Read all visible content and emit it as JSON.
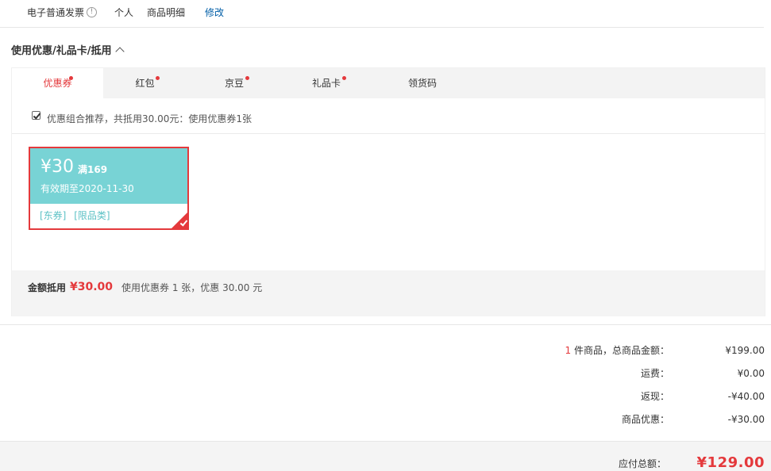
{
  "invoice": {
    "type": "电子普通发票",
    "info_icon": "info-icon",
    "title": "个人",
    "content": "商品明细",
    "edit_label": "修改"
  },
  "coupon_section": {
    "title": "使用优惠/礼品卡/抵用",
    "toggle_icon": "chevron-up-icon",
    "tabs": [
      {
        "label": "优惠券",
        "active": true,
        "dot": true
      },
      {
        "label": "红包",
        "active": false,
        "dot": true
      },
      {
        "label": "京豆",
        "active": false,
        "dot": true
      },
      {
        "label": "礼品卡",
        "active": false,
        "dot": true
      },
      {
        "label": "领货码",
        "active": false,
        "dot": false
      }
    ],
    "recommend": {
      "checked": true,
      "text": "优惠组合推荐，共抵用30.00元：使用优惠券1张"
    },
    "coupon": {
      "amount": "¥30",
      "condition": "满169",
      "expiry": "有效期至2020-11-30",
      "tags": [
        "[东券]",
        "[限品类]"
      ],
      "selected": true
    },
    "summary": {
      "label": "金额抵用",
      "amount": "¥30.00",
      "desc": "使用优惠券 1 张，优惠 30.00 元"
    }
  },
  "totals": {
    "item_count": "1",
    "items_label": " 件商品，总商品金额：",
    "items_value": "¥199.00",
    "shipping_label": "运费：",
    "shipping_value": "¥0.00",
    "cashback_label": "返现：",
    "cashback_value": "-¥40.00",
    "discount_label": "商品优惠：",
    "discount_value": "-¥30.00"
  },
  "payable": {
    "label": "应付总额：",
    "amount": "¥129.00"
  },
  "colors": {
    "accent_red": "#e4393c",
    "coupon_teal": "#78d3d5",
    "link_blue": "#005ea7"
  }
}
